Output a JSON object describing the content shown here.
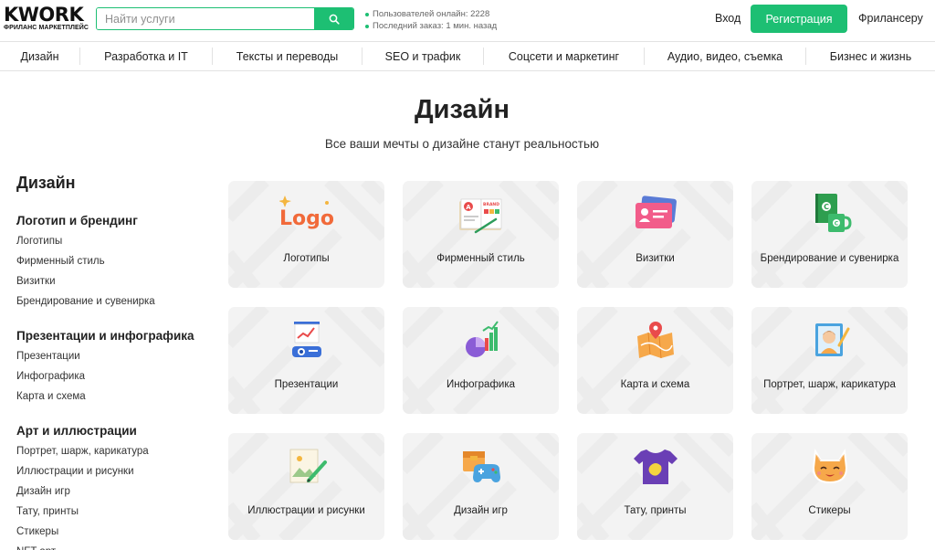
{
  "header": {
    "logo_text": "KWORK",
    "logo_subtext": "ФРИЛАНС МАРКЕТПЛЕЙС",
    "search_placeholder": "Найти услуги",
    "stats": [
      "Пользователей онлайн: 2228",
      "Последний заказ: 1 мин. назад"
    ],
    "login_label": "Вход",
    "register_label": "Регистрация",
    "freelancer_label": "Фрилансеру",
    "accent_color": "#1dbf73"
  },
  "nav": {
    "items": [
      "Дизайн",
      "Разработка и IT",
      "Тексты и переводы",
      "SEO и трафик",
      "Соцсети и маркетинг",
      "Аудио, видео, съемка",
      "Бизнес и жизнь"
    ]
  },
  "hero": {
    "title": "Дизайн",
    "subtitle": "Все ваши мечты о дизайне станут реальностью"
  },
  "sidebar": {
    "title": "Дизайн",
    "groups": [
      {
        "title": "Логотип и брендинг",
        "items": [
          "Логотипы",
          "Фирменный стиль",
          "Визитки",
          "Брендирование и сувенирка"
        ]
      },
      {
        "title": "Презентации и инфографика",
        "items": [
          "Презентации",
          "Инфографика",
          "Карта и схема"
        ]
      },
      {
        "title": "Арт и иллюстрации",
        "items": [
          "Портрет, шарж, карикатура",
          "Иллюстрации и рисунки",
          "Дизайн игр",
          "Тату, принты",
          "Стикеры",
          "NFT арт"
        ]
      }
    ]
  },
  "cards": [
    {
      "label": "Логотипы",
      "icon": "logo-icon"
    },
    {
      "label": "Фирменный стиль",
      "icon": "brand-book-icon"
    },
    {
      "label": "Визитки",
      "icon": "business-card-icon"
    },
    {
      "label": "Брендирование и сувенирка",
      "icon": "branded-notebook-mug-icon"
    },
    {
      "label": "Презентации",
      "icon": "presentation-projector-icon"
    },
    {
      "label": "Инфографика",
      "icon": "infographic-chart-icon"
    },
    {
      "label": "Карта и схема",
      "icon": "map-pin-icon"
    },
    {
      "label": "Портрет, шарж, карикатура",
      "icon": "portrait-frame-icon"
    },
    {
      "label": "Иллюстрации и рисунки",
      "icon": "illustration-pencil-icon"
    },
    {
      "label": "Дизайн игр",
      "icon": "game-gamepad-icon"
    },
    {
      "label": "Тату, принты",
      "icon": "tshirt-print-icon"
    },
    {
      "label": "Стикеры",
      "icon": "cat-sticker-icon"
    }
  ]
}
